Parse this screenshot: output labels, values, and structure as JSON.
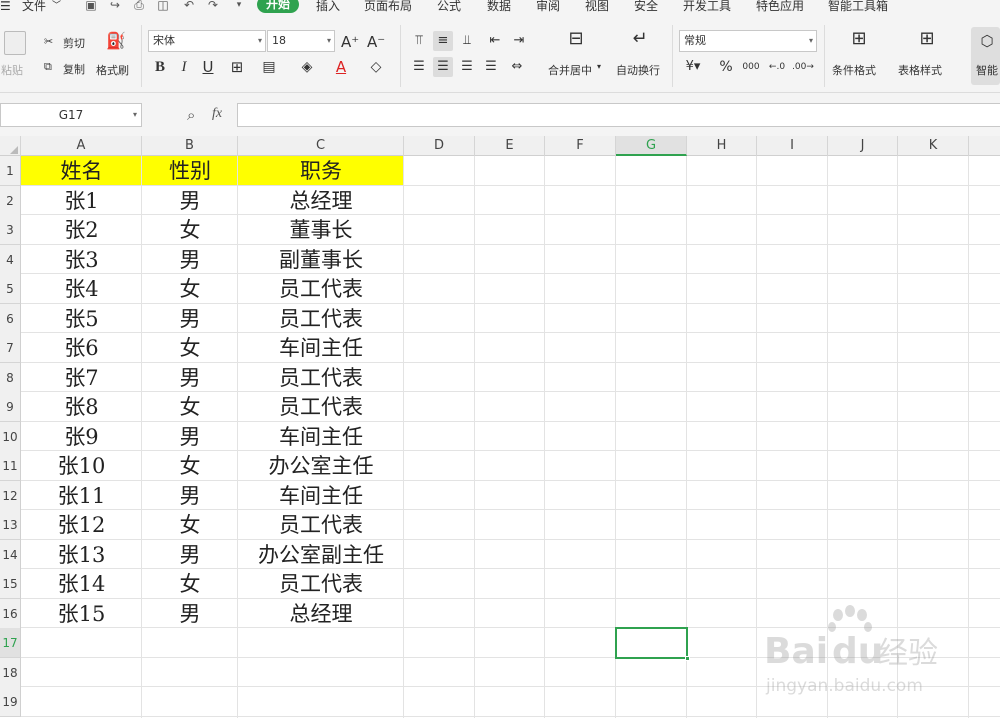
{
  "menubar": {
    "file": "文件",
    "tabs": [
      "开始",
      "插入",
      "页面布局",
      "公式",
      "数据",
      "审阅",
      "视图",
      "安全",
      "开发工具",
      "特色应用",
      "智能工具箱"
    ]
  },
  "toolbar": {
    "paste": "粘贴",
    "cut": "剪切",
    "copy": "复制",
    "format_painter": "格式刷",
    "font_name": "宋体",
    "font_size": "18",
    "bold": "B",
    "italic": "I",
    "underline": "U",
    "merge_center": "合并居中",
    "wrap_text": "自动换行",
    "number_format": "常规",
    "percent": "%",
    "thousands": "000",
    "conditional_format": "条件格式",
    "table_style": "表格样式",
    "smart": "智能"
  },
  "formula_bar": {
    "name_box": "G17",
    "fx": "fx",
    "value": ""
  },
  "columns": [
    "A",
    "B",
    "C",
    "D",
    "E",
    "F",
    "G",
    "H",
    "I",
    "J",
    "K"
  ],
  "row_numbers": [
    "1",
    "2",
    "3",
    "4",
    "5",
    "6",
    "7",
    "8",
    "9",
    "10",
    "11",
    "12",
    "13",
    "14",
    "15",
    "16",
    "17",
    "18",
    "19"
  ],
  "sheet": {
    "headers": [
      "姓名",
      "性别",
      "职务"
    ],
    "rows": [
      [
        "张1",
        "男",
        "总经理"
      ],
      [
        "张2",
        "女",
        "董事长"
      ],
      [
        "张3",
        "男",
        "副董事长"
      ],
      [
        "张4",
        "女",
        "员工代表"
      ],
      [
        "张5",
        "男",
        "员工代表"
      ],
      [
        "张6",
        "女",
        "车间主任"
      ],
      [
        "张7",
        "男",
        "员工代表"
      ],
      [
        "张8",
        "女",
        "员工代表"
      ],
      [
        "张9",
        "男",
        "车间主任"
      ],
      [
        "张10",
        "女",
        "办公室主任"
      ],
      [
        "张11",
        "男",
        "车间主任"
      ],
      [
        "张12",
        "女",
        "员工代表"
      ],
      [
        "张13",
        "男",
        "办公室副主任"
      ],
      [
        "张14",
        "女",
        "员工代表"
      ],
      [
        "张15",
        "男",
        "总经理"
      ]
    ]
  },
  "watermark": {
    "brand": "Bai",
    "brand_suffix": "du",
    "text": "经验",
    "url": "jingyan.baidu.com"
  },
  "colors": {
    "accent": "#2fa24f",
    "header_fill": "#ffff00"
  }
}
